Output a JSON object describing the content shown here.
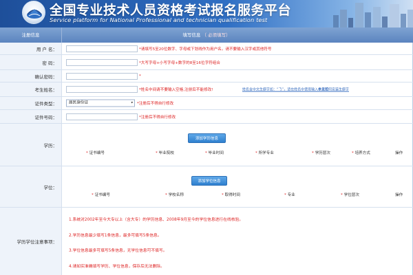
{
  "header": {
    "title": "全国专业技术人员资格考试报名服务平台",
    "subtitle": "Service platform for National Professional and technician qualification test"
  },
  "colors": {
    "banner": "#2f6fc4",
    "table_head": "#6b92c8",
    "label_bg": "#eef3fa",
    "required": "#dd2222",
    "button": "#3a8ad6"
  },
  "form_head": {
    "left": "注册信息",
    "center": "填写信息",
    "center_hint": "（ 必须填写）"
  },
  "fields": {
    "username": {
      "label": "用 户 名：",
      "value": "",
      "note": "*请填写5至20位数字、字母或下划线作为用户名。请不要输入汉字或其他符号"
    },
    "password": {
      "label": "密 码：",
      "value": "",
      "note": "*大写字母+小写字母+数字的8至16位字符组合"
    },
    "confirm": {
      "label": "确认密码：",
      "value": "",
      "note": "*"
    },
    "name": {
      "label": "考生姓名：",
      "value": "",
      "note": "*姓名中间请不要输入空格,注册后不能修改!",
      "link1": "姓名含中文生僻字如：“𠄎”，请在姓名中使用输入本发明",
      "link2": "参见如何安装生僻字"
    },
    "id_type": {
      "label": "证件类型：",
      "selected": "居民身份证",
      "note": "*注册后不得自行修改"
    },
    "id_number": {
      "label": "证件号码：",
      "value": "",
      "note": "*注册后不得自行修改"
    }
  },
  "education": {
    "label": "学历：",
    "add_button": "添加学历信息",
    "columns": [
      "证书编号",
      "毕业院校",
      "毕业时间",
      "所学专业",
      "学历层次",
      "培养方式",
      "操作"
    ]
  },
  "degree": {
    "label": "学位：",
    "add_button": "添加学位信息",
    "columns": [
      "证书编号",
      "学校名称",
      "取得时间",
      "专业",
      "学位层次",
      "操作"
    ]
  },
  "notes": {
    "label": "学历学位注意事项：",
    "items": [
      "1.系统对2002年至今大专以上（含大专）的学历信息、2008年9月至今的学位信息进行在线核验。",
      "2.学历信息最少填写1条信息，最多可填写5条信息。",
      "3.学位信息最多可填写5条信息，无学位信息可不填写。",
      "4.请如实准确填写学历、学位信息，保存后无法删除。"
    ]
  }
}
